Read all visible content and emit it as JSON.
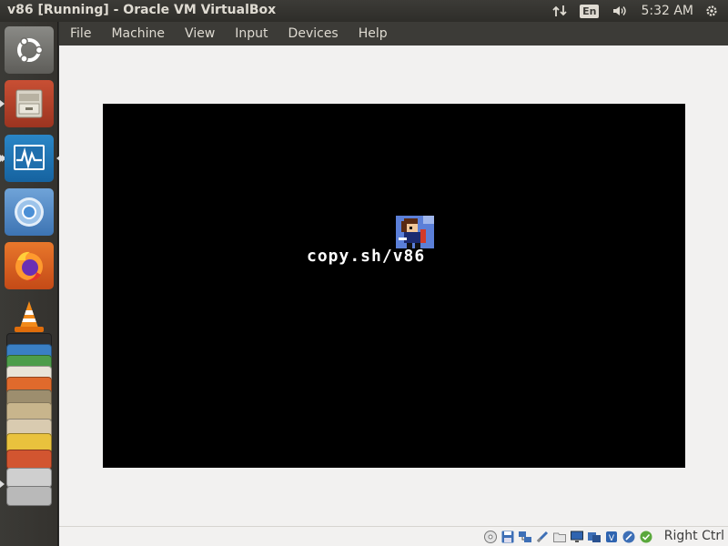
{
  "window": {
    "title": "v86 [Running] - Oracle VM VirtualBox"
  },
  "top_panel": {
    "indicators": {
      "network_icon": "network-arrows-icon",
      "keyboard_layout": "En",
      "volume_icon": "speaker-icon",
      "clock": "5:32 AM",
      "settings_icon": "gear-icon"
    }
  },
  "launcher": {
    "items": [
      {
        "name": "ubuntu-dash",
        "icon": "ubuntu-logo-icon"
      },
      {
        "name": "files",
        "icon": "file-cabinet-icon"
      },
      {
        "name": "system-monitor",
        "icon": "system-monitor-icon"
      },
      {
        "name": "chromium",
        "icon": "chromium-icon"
      },
      {
        "name": "firefox",
        "icon": "firefox-icon"
      },
      {
        "name": "vlc",
        "icon": "vlc-cone-icon"
      }
    ]
  },
  "menubar": {
    "items": [
      "File",
      "Machine",
      "View",
      "Input",
      "Devices",
      "Help"
    ]
  },
  "vm_screen": {
    "text": "copy.sh/v86",
    "logo_icon": "v86-pixel-character-icon"
  },
  "statusbar": {
    "icons": [
      "optical-drive-icon",
      "floppy-disk-icon",
      "network-adapter-icon",
      "usb-icon",
      "shared-folders-icon",
      "display-icon",
      "video-capture-icon",
      "virtualization-icon",
      "mouse-integration-icon",
      "cpu-status-icon"
    ],
    "host_key": "Right Ctrl"
  },
  "colors": {
    "panel": "#3c3b37",
    "panel_text": "#dfdbd2",
    "vm_background": "#000000",
    "client_background": "#f2f1f0"
  }
}
